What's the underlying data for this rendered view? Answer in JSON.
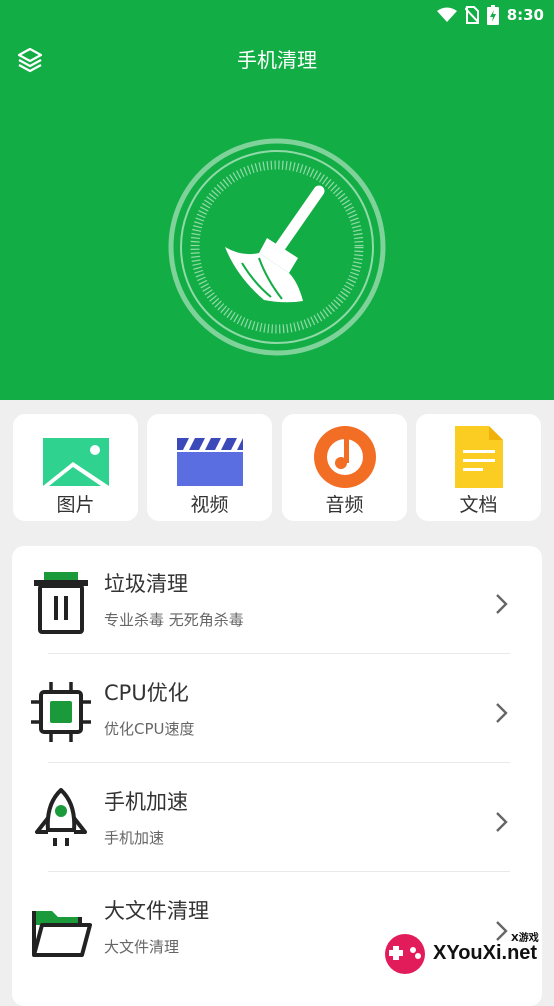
{
  "status_bar": {
    "time": "8:30",
    "icons": [
      "wifi-icon",
      "no-sim-icon",
      "battery-charging-icon"
    ]
  },
  "header": {
    "title": "手机清理",
    "menu_icon": "layers-icon",
    "hero_icon": "broom-icon",
    "color": "#13ad45"
  },
  "quick_actions": [
    {
      "label": "图片",
      "icon": "image-icon"
    },
    {
      "label": "视频",
      "icon": "clapperboard-icon"
    },
    {
      "label": "音频",
      "icon": "music-icon"
    },
    {
      "label": "文档",
      "icon": "document-icon"
    }
  ],
  "features": [
    {
      "title": "垃圾清理",
      "subtitle": "专业杀毒 无死角杀毒",
      "icon": "trash-icon"
    },
    {
      "title": "CPU优化",
      "subtitle": "优化CPU速度",
      "icon": "cpu-chip-icon"
    },
    {
      "title": "手机加速",
      "subtitle": "手机加速",
      "icon": "rocket-icon"
    },
    {
      "title": "大文件清理",
      "subtitle": "大文件清理",
      "icon": "folder-icon"
    }
  ],
  "watermark": {
    "text": "XYouXi.net",
    "small": "X游戏"
  }
}
